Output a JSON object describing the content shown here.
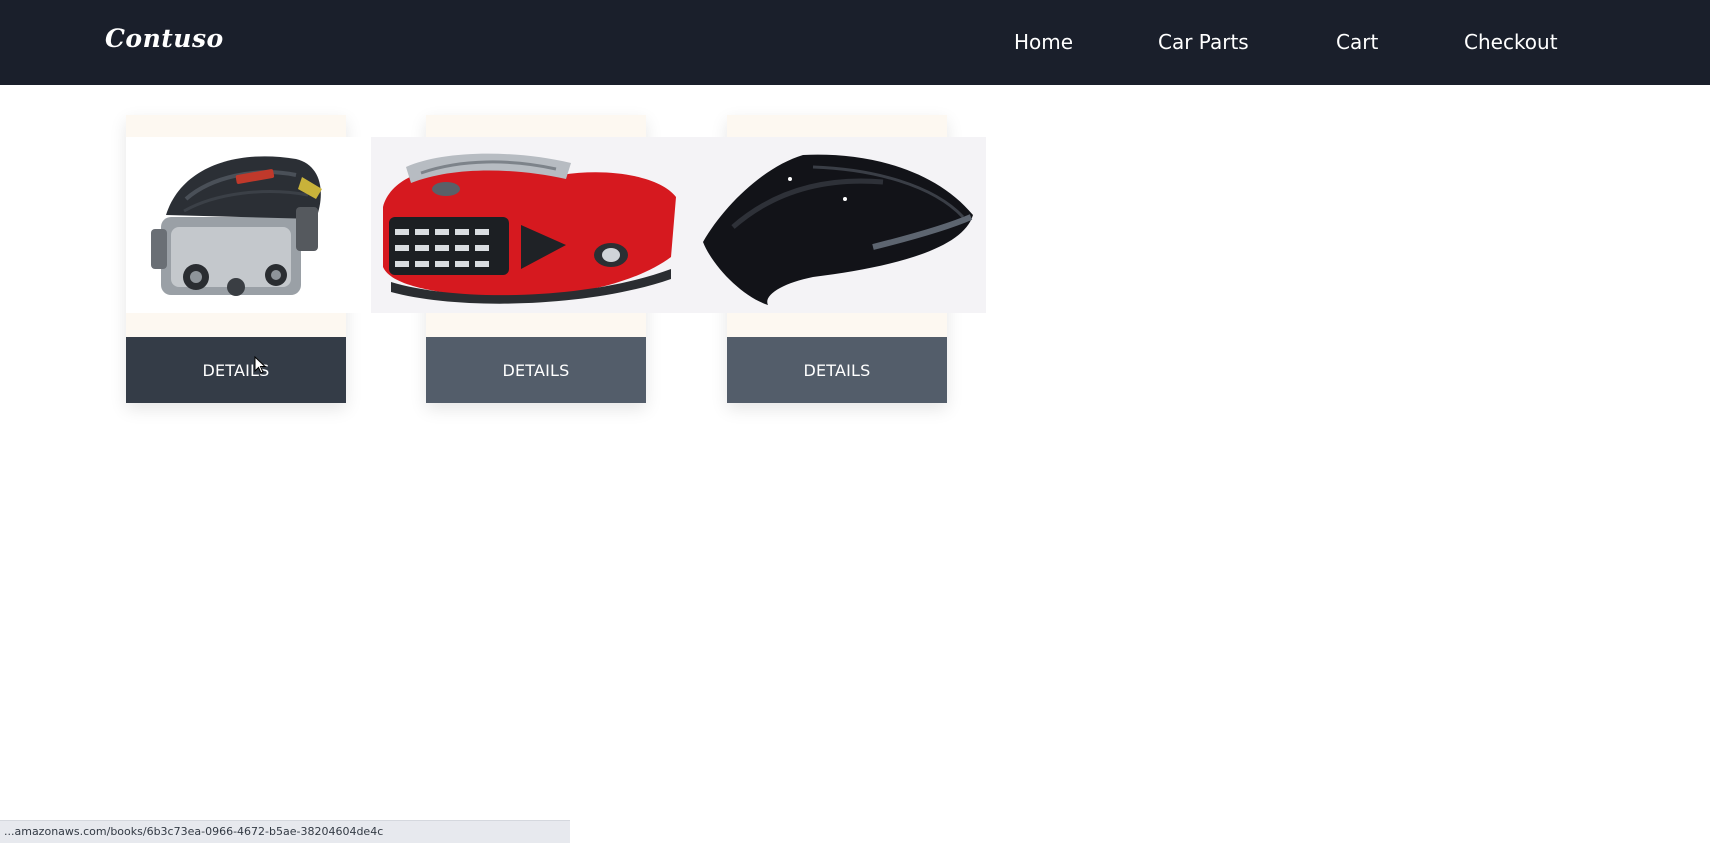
{
  "navbar": {
    "logo": "Contuso",
    "links": [
      {
        "label": "Home"
      },
      {
        "label": "Car Parts"
      },
      {
        "label": "Cart"
      },
      {
        "label": "Checkout"
      }
    ]
  },
  "products": [
    {
      "image": "engine-image",
      "button_label": "DETAILS"
    },
    {
      "image": "front-bumper-image",
      "button_label": "DETAILS"
    },
    {
      "image": "hood-image",
      "button_label": "DETAILS"
    }
  ],
  "status_bar": {
    "url": "...amazonaws.com/books/6b3c73ea-0966-4672-b5ae-38204604de4c"
  },
  "colors": {
    "navbar_bg": "#1a1f2b",
    "button_hover": "#343c47",
    "button": "#535d6a",
    "card_bg": "#fdf8f1",
    "bumper_red": "#d6191f"
  }
}
